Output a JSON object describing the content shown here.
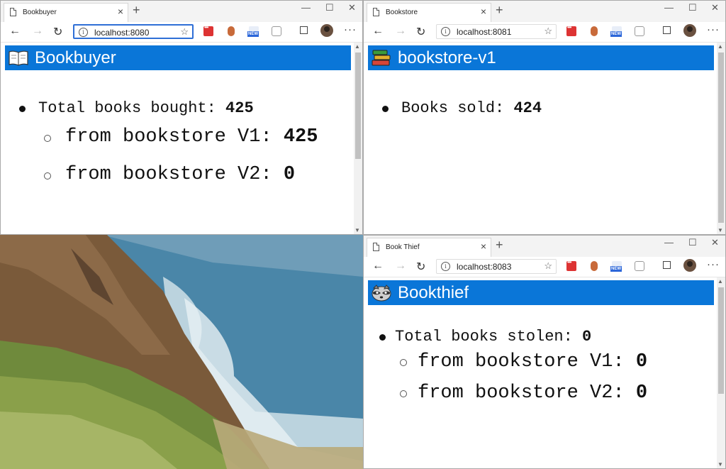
{
  "windows": {
    "bookbuyer": {
      "tab_title": "Bookbuyer",
      "url": "localhost:8080",
      "banner_title": "Bookbuyer",
      "banner_icon": "open-book-emoji",
      "line1_label": "Total books bought: ",
      "line1_value": "425",
      "line2_label": "from bookstore V1: ",
      "line2_value": "425",
      "line3_label": "from bookstore V2: ",
      "line3_value": "0"
    },
    "bookstore": {
      "tab_title": "Bookstore",
      "url": "localhost:8081",
      "banner_title": "bookstore-v1",
      "banner_icon": "books-stack-emoji",
      "line1_label": "Books sold: ",
      "line1_value": "424"
    },
    "bookthief": {
      "tab_title": "Book Thief",
      "url": "localhost:8083",
      "banner_title": "Bookthief",
      "banner_icon": "raccoon-emoji",
      "line1_label": "Total books stolen: ",
      "line1_value": "0",
      "line2_label": "from bookstore V1: ",
      "line2_value": "0",
      "line3_label": "from bookstore V2: ",
      "line3_value": "0"
    }
  },
  "toolbar_icons": [
    "back-arrow-icon",
    "forward-arrow-icon",
    "refresh-icon",
    "info-icon",
    "favorite-star-icon",
    "red-extension-icon",
    "fox-extension-icon",
    "new-badge-extension-icon",
    "capture-extension-icon",
    "collections-icon",
    "profile-avatar",
    "more-menu-icon"
  ],
  "colors": {
    "banner_blue": "#0a76d8",
    "titlebar": "#f3f3f3"
  },
  "new_badge_text": "NEW"
}
